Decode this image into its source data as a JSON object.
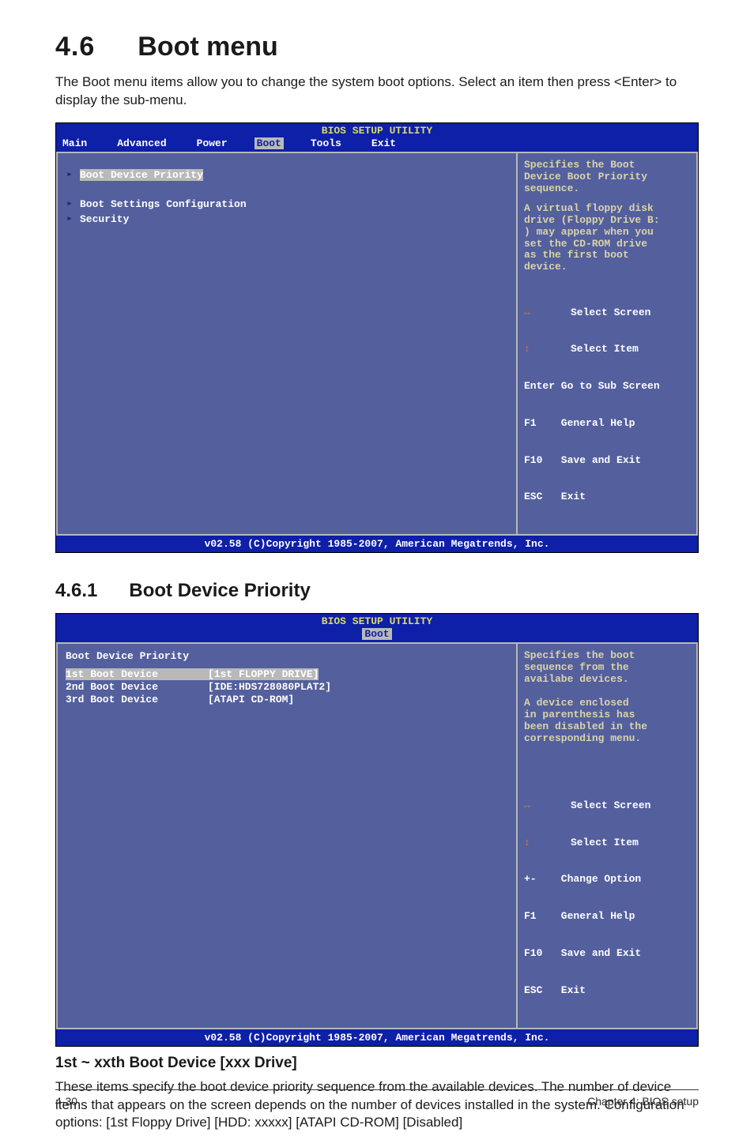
{
  "heading": {
    "number": "4.6",
    "title": "Boot menu"
  },
  "intro": "The Boot menu items allow you to change the system boot options. Select an item then press <Enter> to display the sub-menu.",
  "bios1": {
    "title": "BIOS SETUP UTILITY",
    "tabs": [
      "Main",
      "Advanced",
      "Power",
      "Boot",
      "Tools",
      "Exit"
    ],
    "activeTab": "Boot",
    "items": [
      {
        "arrow": "▸",
        "label": "Boot Device Priority",
        "selected": true
      },
      {
        "arrow": "",
        "label": "",
        "spacer": true
      },
      {
        "arrow": "▸",
        "label": "Boot Settings Configuration"
      },
      {
        "arrow": "▸",
        "label": "Security"
      }
    ],
    "help_desc1": "Specifies the Boot\nDevice Boot Priority\nsequence.",
    "help_desc2": "A virtual floppy disk\ndrive (Floppy Drive B:\n) may appear when you\nset the CD-ROM drive\nas the first boot\ndevice.",
    "keys": [
      {
        "icon": "↔",
        "label": "     Select Screen"
      },
      {
        "icon": "↕",
        "label": "     Select Item"
      },
      {
        "icon": "",
        "label": "Enter Go to Sub Screen"
      },
      {
        "icon": "",
        "label": "F1    General Help"
      },
      {
        "icon": "",
        "label": "F10   Save and Exit"
      },
      {
        "icon": "",
        "label": "ESC   Exit"
      }
    ],
    "footer": "v02.58 (C)Copyright 1985-2007, American Megatrends, Inc."
  },
  "sub": {
    "number": "4.6.1",
    "title": "Boot Device Priority"
  },
  "bios2": {
    "title": "BIOS SETUP UTILITY",
    "activeTab": "Boot",
    "panel_header": "Boot Device Priority",
    "rows": [
      {
        "label": "1st Boot Device",
        "value": "[1st FLOPPY DRIVE]",
        "selected": true
      },
      {
        "label": "2nd Boot Device",
        "value": "[IDE:HDS728080PLAT2]"
      },
      {
        "label": "3rd Boot Device",
        "value": "[ATAPI CD-ROM]"
      }
    ],
    "help_desc": "Specifies the boot\nsequence from the\navailabe devices.\n\nA device enclosed\nin parenthesis has\nbeen disabled in the\ncorresponding menu.",
    "keys": [
      {
        "icon": "↔",
        "label": "     Select Screen"
      },
      {
        "icon": "↕",
        "label": "     Select Item"
      },
      {
        "icon": "",
        "label": "+-    Change Option"
      },
      {
        "icon": "",
        "label": "F1    General Help"
      },
      {
        "icon": "",
        "label": "F10   Save and Exit"
      },
      {
        "icon": "",
        "label": "ESC   Exit"
      }
    ],
    "footer": "v02.58 (C)Copyright 1985-2007, American Megatrends, Inc."
  },
  "opt_heading": "1st ~ xxth Boot Device [xxx Drive]",
  "opt_text": "These items specify the boot device priority sequence from the available devices. The number of device items that appears on the screen depends on the number of devices installed in the system. Configuration options: [1st Floppy Drive] [HDD: xxxxx] [ATAPI CD-ROM] [Disabled]",
  "footer": {
    "left": "4-30",
    "right": "Chapter 4: BIOS setup"
  }
}
